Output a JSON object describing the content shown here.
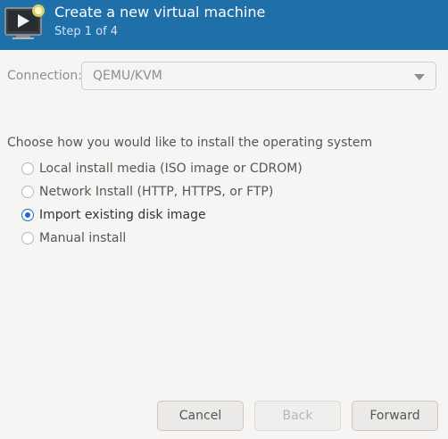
{
  "header": {
    "title": "Create a new virtual machine",
    "subtitle": "Step 1 of 4",
    "icon": "vm-new-icon",
    "background_color": "#1f6fa8"
  },
  "connection": {
    "label": "Connection:",
    "value": "QEMU/KVM"
  },
  "install": {
    "prompt": "Choose how you would like to install the operating system",
    "options": [
      {
        "label": "Local install media (ISO image or CDROM)",
        "selected": false
      },
      {
        "label": "Network Install (HTTP, HTTPS, or FTP)",
        "selected": false
      },
      {
        "label": "Import existing disk image",
        "selected": true
      },
      {
        "label": "Manual install",
        "selected": false
      }
    ]
  },
  "buttons": {
    "cancel": "Cancel",
    "back": "Back",
    "forward": "Forward"
  },
  "colors": {
    "accent": "#1b6acb"
  }
}
